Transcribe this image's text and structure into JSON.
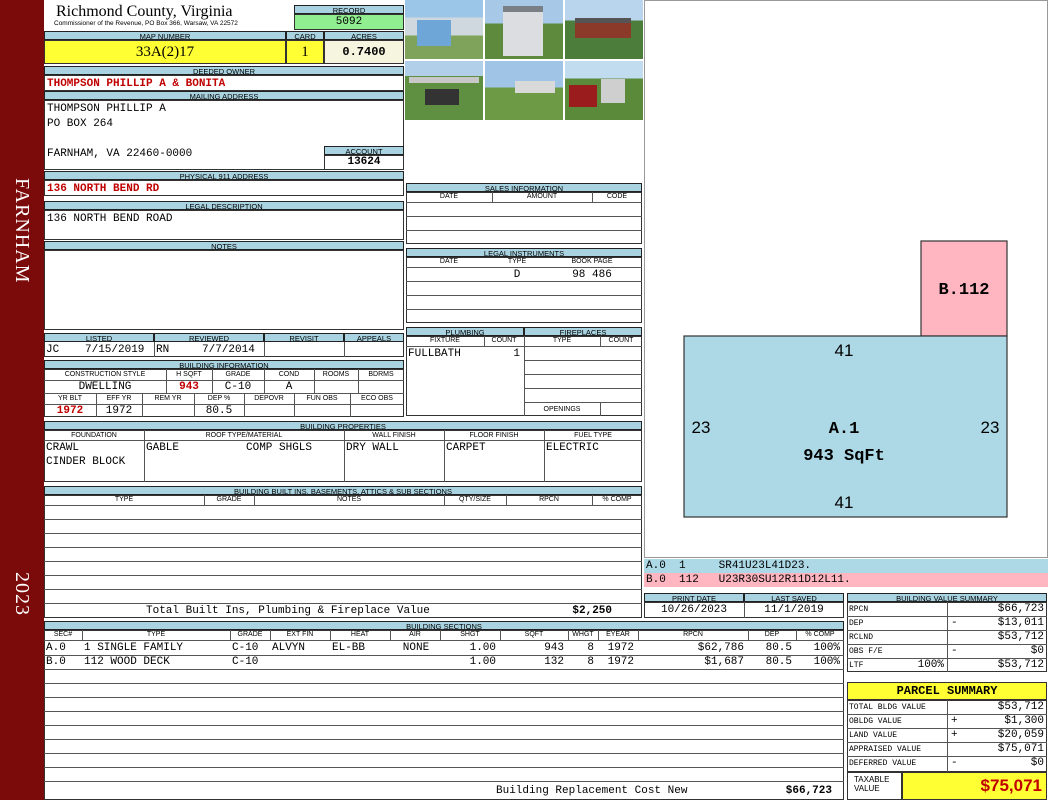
{
  "sidebar": {
    "town": "FARNHAM",
    "year": "2023"
  },
  "header": {
    "county": "Richmond County, Virginia",
    "commissioner": "Commissioner of the Revenue, PO Box 366, Warsaw, VA 22572",
    "record_label": "RECORD",
    "record": "5092",
    "map_label": "MAP NUMBER",
    "map_number": "33A(2)17",
    "card_label": "CARD",
    "card": "1",
    "acres_label": "ACRES",
    "acres": "0.7400"
  },
  "owner": {
    "label": "DEEDED OWNER",
    "name": "THOMPSON PHILLIP A & BONITA",
    "mailing_label": "MAILING ADDRESS",
    "line1": "THOMPSON PHILLIP A",
    "line2": "PO BOX 264",
    "line3": "FARNHAM, VA 22460-0000",
    "account_label": "ACCOUNT",
    "account": "13624"
  },
  "physical": {
    "label": "PHYSICAL 911 ADDRESS",
    "address": "136 NORTH BEND RD"
  },
  "legal": {
    "label": "LEGAL DESCRIPTION",
    "description": "136 NORTH BEND ROAD"
  },
  "notes": {
    "label": "NOTES"
  },
  "review": {
    "listed_label": "LISTED",
    "reviewed_label": "REVIEWED",
    "revisit_label": "REVISIT",
    "appeals_label": "APPEALS",
    "listed_by": "JC",
    "listed_date": "7/15/2019",
    "reviewed_by": "RN",
    "reviewed_date": "7/7/2014"
  },
  "building_info": {
    "label": "BUILDING INFORMATION",
    "style_label": "CONSTRUCTION STYLE",
    "hsqft_label": "H SQFT",
    "grade_label": "GRADE",
    "cond_label": "COND",
    "rooms_label": "ROOMS",
    "bdrms_label": "BDRMS",
    "style": "DWELLING",
    "hsqft": "943",
    "grade": "C-10",
    "cond": "A",
    "yrblt_label": "YR BLT",
    "effyr_label": "EFF YR",
    "remyr_label": "REM YR",
    "dep_label": "DEP %",
    "depovr_label": "DEPOVR",
    "funobs_label": "FUN OBS",
    "ecoobs_label": "ECO OBS",
    "yrblt": "1972",
    "effyr": "1972",
    "dep": "80.5"
  },
  "sales": {
    "label": "SALES INFORMATION",
    "date_label": "DATE",
    "amount_label": "AMOUNT",
    "code_label": "CODE"
  },
  "instruments": {
    "label": "LEGAL INSTRUMENTS",
    "date_label": "DATE",
    "type_label": "TYPE",
    "bookpage_label": "BOOK PAGE",
    "type": "D",
    "bookpage": "98 486"
  },
  "plumbing": {
    "label": "PLUMBING",
    "fixture_label": "FIXTURE",
    "count_label": "COUNT",
    "fixture": "FULLBATH",
    "count": "1"
  },
  "fireplaces": {
    "label": "FIREPLACES",
    "type_label": "TYPE",
    "count_label": "COUNT",
    "openings_label": "OPENINGS"
  },
  "properties": {
    "label": "BUILDING PROPERTIES",
    "foundation_label": "FOUNDATION",
    "roof_label": "ROOF TYPE/MATERIAL",
    "wall_label": "WALL FINISH",
    "floor_label": "FLOOR FINISH",
    "fuel_label": "FUEL TYPE",
    "foundation1": "CRAWL",
    "foundation2": "CINDER BLOCK",
    "roof_type": "GABLE",
    "roof_material": "COMP SHGLS",
    "wall": "DRY WALL",
    "floor": "CARPET",
    "fuel": "ELECTRIC"
  },
  "builtins": {
    "label": "BUILDING BUILT INS, BASEMENTS, ATTICS & SUB SECTIONS",
    "type_label": "TYPE",
    "grade_label": "GRADE",
    "notes_label": "NOTES",
    "qty_label": "QTY/SIZE",
    "rpcn_label": "RPCN",
    "pcomp_label": "% COMP",
    "total_label": "Total Built Ins, Plumbing & Fireplace Value",
    "total": "$2,250"
  },
  "dates": {
    "print_label": "PRINT DATE",
    "saved_label": "LAST SAVED",
    "print": "10/26/2023",
    "saved": "11/1/2019"
  },
  "sections": {
    "label": "BUILDING SECTIONS",
    "headers": [
      "SEC#",
      "TYPE",
      "GRADE",
      "EXT FIN",
      "HEAT",
      "AIR",
      "SHGT",
      "SQFT",
      "WHGT",
      "EYEAR",
      "RPCN",
      "DEP",
      "% COMP"
    ],
    "rows": [
      {
        "sec": "A.0",
        "type": "1 SINGLE FAMILY",
        "grade": "C-10",
        "extfin": "ALVYN",
        "heat": "EL-BB",
        "air": "NONE",
        "shgt": "1.00",
        "sqft": "943",
        "whgt": "8",
        "eyear": "1972",
        "rpcn": "$62,786",
        "dep": "80.5",
        "comp": "100%"
      },
      {
        "sec": "B.0",
        "type": "112 WOOD DECK",
        "grade": "C-10",
        "extfin": "",
        "heat": "",
        "air": "",
        "shgt": "1.00",
        "sqft": "132",
        "whgt": "8",
        "eyear": "1972",
        "rpcn": "$1,687",
        "dep": "80.5",
        "comp": "100%"
      }
    ],
    "replacement_label": "Building Replacement Cost New",
    "replacement": "$66,723"
  },
  "sketch": {
    "a_label": "A.1",
    "a_area": "943 SqFt",
    "top": "41",
    "bottom": "41",
    "left": "23",
    "right": "23",
    "b_label": "B.112",
    "a_color": "#add8e6",
    "b_color": "#ffb6c1",
    "line_a": "A.0  1     SR41U23L41D23.",
    "line_b": "B.0  112   U23R30SU12R11D12L11."
  },
  "value_summary": {
    "label": "BUILDING VALUE SUMMARY",
    "rows": [
      {
        "label": "RPCN",
        "sign": "",
        "value": "$66,723"
      },
      {
        "label": "DEP",
        "sign": "-",
        "value": "$13,011"
      },
      {
        "label": "RCLND",
        "sign": "",
        "value": "$53,712"
      },
      {
        "label": "OBS F/E",
        "sign": "-",
        "value": "$0"
      },
      {
        "label": "LTF",
        "pct": "100%",
        "sign": "",
        "value": "$53,712"
      }
    ]
  },
  "parcel": {
    "label": "PARCEL SUMMARY",
    "rows": [
      {
        "label": "TOTAL BLDG VALUE",
        "sign": "",
        "value": "$53,712"
      },
      {
        "label": "OBLDG VALUE",
        "sign": "+",
        "value": "$1,300"
      },
      {
        "label": "LAND VALUE",
        "sign": "+",
        "value": "$20,059"
      },
      {
        "label": "APPRAISED VALUE",
        "sign": "",
        "value": "$75,071"
      },
      {
        "label": "DEFERRED VALUE",
        "sign": "-",
        "value": "$0"
      }
    ],
    "taxable_label": "TAXABLE VALUE",
    "taxable": "$75,071"
  }
}
